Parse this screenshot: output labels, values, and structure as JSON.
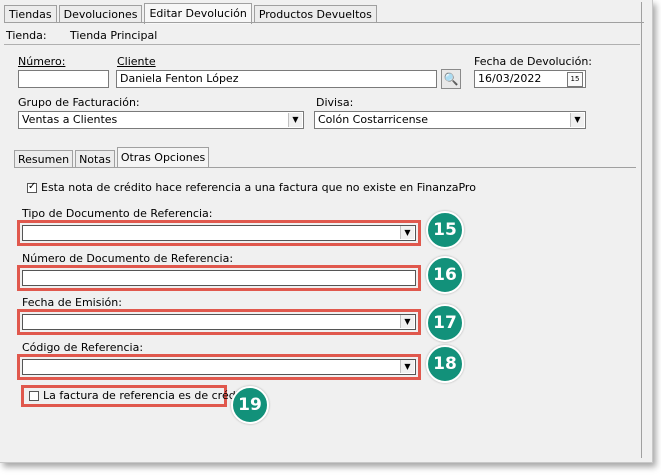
{
  "top_tabs": [
    "Tiendas",
    "Devoluciones",
    "Editar Devolución",
    "Productos Devueltos"
  ],
  "store": {
    "label": "Tienda:",
    "value": "Tienda Principal"
  },
  "form": {
    "numero_label": "Número:",
    "numero_value": "",
    "cliente_label": "Cliente",
    "cliente_value": "Daniela Fenton López",
    "fecha_label": "Fecha de Devolución:",
    "fecha_value": "16/03/2022",
    "grupo_label": "Grupo de Facturación:",
    "grupo_value": "Ventas a Clientes",
    "divisa_label": "Divisa:",
    "divisa_value": "Colón Costarricense"
  },
  "inner_tabs": [
    "Resumen",
    "Notas",
    "Otras Opciones"
  ],
  "otras": {
    "ref_check_label": "Esta nota de crédito hace referencia a una factura que no existe en FinanzaPro",
    "ref_check_checked": true,
    "tipo_label": "Tipo de Documento de Referencia:",
    "tipo_value": "",
    "numero_ref_label": "Número de Documento de Referencia:",
    "numero_ref_value": "",
    "fecha_emision_label": "Fecha de Emisión:",
    "fecha_emision_value": "",
    "codigo_label": "Código de Referencia:",
    "codigo_value": "",
    "credito_label": "La factura de referencia es de crédito",
    "credito_checked": false
  },
  "badges": [
    "15",
    "16",
    "17",
    "18",
    "19"
  ],
  "icons": {
    "search": "search-icon",
    "calendar": "calendar-icon",
    "dropdown": "chevron-down-icon"
  },
  "colors": {
    "highlight": "#e0584d",
    "badge": "#12917a"
  }
}
